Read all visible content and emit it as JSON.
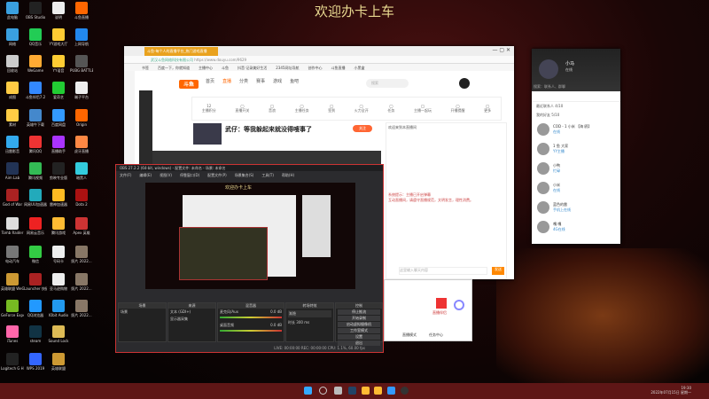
{
  "desktop": {
    "banner": "欢迎办卡上车",
    "icons": [
      [
        "此电脑",
        "#3aa0e0"
      ],
      [
        "OBS Studio",
        "#222"
      ],
      [
        "说明",
        "#eee"
      ],
      [
        "斗鱼直播",
        "#f60"
      ],
      [
        "网络",
        "#3aa0e0"
      ],
      [
        "QQ音乐",
        "#2c5"
      ],
      [
        "YY游戏大厅",
        "#fc3"
      ],
      [
        "上网导航",
        "#28e"
      ],
      [
        "回收站",
        "#ccc"
      ],
      [
        "WeGame",
        "#fa3"
      ],
      [
        "YY语音",
        "#fc3"
      ],
      [
        "PUBG BATTLEGR...",
        "#555"
      ],
      [
        "成图",
        "#fc4"
      ],
      [
        "斗鱼伴侣7.2",
        "#38f"
      ],
      [
        "爱奇艺",
        "#2c3"
      ],
      [
        "端子平台",
        "#eee"
      ],
      [
        "素材",
        "#fc4"
      ],
      [
        "英雄牛下载",
        "#48c"
      ],
      [
        "百度网盘",
        "#39f"
      ],
      [
        "Origin",
        "#f60"
      ],
      [
        "迅雷影音",
        "#3ae"
      ],
      [
        "腾讯QQ",
        "#e33"
      ],
      [
        "直播助手",
        "#a3f"
      ],
      [
        "虎牙直播",
        "#f84"
      ],
      [
        "Aim Lab",
        "#235"
      ],
      [
        "腾讯视频",
        "#3b5"
      ],
      [
        "剪映专业版",
        "#222"
      ],
      [
        "暗黑人",
        "#3cd"
      ],
      [
        "God of War",
        "#a22"
      ],
      [
        "网易UU加速器",
        "#2ab"
      ],
      [
        "雷神加速器",
        "#fb2"
      ],
      [
        "Dota 2",
        "#a11"
      ],
      [
        "Tomb Raider",
        "#ddd"
      ],
      [
        "网易云音乐",
        "#e22"
      ],
      [
        "腾讯游戏",
        "#fb3"
      ],
      [
        "Apex 英雄",
        "#c33"
      ],
      [
        "电动汽车",
        "#777"
      ],
      [
        "微信",
        "#3c4"
      ],
      [
        "号码卡",
        "#eee"
      ],
      [
        "照片 2022...",
        "#876"
      ],
      [
        "英雄联盟 WeGame版",
        "#c93"
      ],
      [
        "Launcher 快捷方式",
        "#a22"
      ],
      [
        "亚马逊购物",
        "#eee"
      ],
      [
        "照片 2022...",
        "#876"
      ],
      [
        "GeForce Experience",
        "#7b2"
      ],
      [
        "QQ浏览器",
        "#29f"
      ],
      [
        "IObit Audio",
        "#29e"
      ],
      [
        "照片 2022...",
        "#876"
      ],
      [
        "iTunes",
        "#f6a"
      ],
      [
        "steam",
        "#134"
      ],
      [
        "Sound Lock",
        "#db5"
      ],
      [
        "",
        ""
      ],
      [
        "Logitech G HUB",
        "#222"
      ],
      [
        "WPS 2019",
        "#36f"
      ],
      [
        "英雄联盟",
        "#c93"
      ],
      [
        "",
        ""
      ]
    ]
  },
  "browser": {
    "tab": "斗鱼-每个人的直播平台_热门游戏直播",
    "url": "https://www.douyu.com/9629",
    "site_owner": "武汉斗鱼网络科技有限公司",
    "bookmarks": [
      "书签",
      "百度一下，你就知道",
      "主播中心",
      "斗鱼",
      "抖音·记录美好生活",
      "2345网址导航",
      "创作中心",
      "斗鱼直播",
      "小黑盒"
    ],
    "logo": "斗鱼",
    "nav": [
      "首页",
      "直播",
      "分类",
      "赛事",
      "游戏",
      "鱼吧"
    ],
    "search_placeholder": "搜索",
    "tools": [
      "主播积分",
      "直播开关",
      "音浪",
      "主播任务",
      "签到",
      "火力全开",
      "任务",
      "主播一起玩",
      "开播提醒",
      "更多"
    ],
    "score": "12",
    "room_title": "武仔：等我躲起来就没得嗖事了",
    "follow": "关注",
    "chat": [
      "欢迎来到本直播间",
      "系统提示：主播已开启弹幕",
      "互动直播间，请遵守直播规范，文明发言，理性消费。",
      "发送"
    ],
    "chat_placeholder": "这里输入聊天内容"
  },
  "obs": {
    "title": "OBS 27.2.2 (64-bit, windows) - 配置文件: 未命名 - 场景: 未命名",
    "menu": [
      "文件(F)",
      "编辑(E)",
      "视图(V)",
      "停靠窗口(D)",
      "配置文件(P)",
      "场景集合(S)",
      "工具(T)",
      "帮助(H)"
    ],
    "preview_banner": "欢迎办卡上车",
    "panels": {
      "scenes": "场景",
      "sources": "来源",
      "mixer": "混音器",
      "transitions": "转场特效",
      "controls": "控制"
    },
    "scene": "场景",
    "sources": [
      "文本 (GDI+)",
      "显示器采集"
    ],
    "mixer": [
      {
        "name": "麦克风/Aux",
        "db": "0.0 dB"
      },
      {
        "name": "桌面音频",
        "db": "0.0 dB"
      }
    ],
    "transition": "渐隐",
    "duration_label": "时长",
    "duration": "300 ms",
    "controls": [
      "停止推流",
      "开始录制",
      "启动虚拟摄像机",
      "工作室模式",
      "设置",
      "退出"
    ],
    "status": "LIVE: 00:00:00   REC: 00:00:00   CPU: 1.1%, 60.00 fps"
  },
  "popup": {
    "label": "直播伴侣",
    "footer": [
      "直播模式",
      "任务中心"
    ]
  },
  "qq": {
    "name": "小马",
    "status": "在线",
    "search": "搜索：联系人、群聊",
    "groups": [
      "最近联系人 4/10",
      "我的好友 5/10"
    ],
    "friends": [
      [
        "COD - 1 小米 【海 鸥】",
        "在线"
      ],
      [
        "1 鱼 大家",
        "YY主播"
      ],
      [
        "小鸭",
        "忙碌"
      ],
      [
        "小米",
        "在线"
      ],
      [
        "蓝色的雷",
        "手机上在线"
      ],
      [
        "嘎 嘎",
        "4G在线"
      ]
    ]
  },
  "taskbar": {
    "time": "19:30",
    "date": "2022年07月15日 星期一"
  }
}
